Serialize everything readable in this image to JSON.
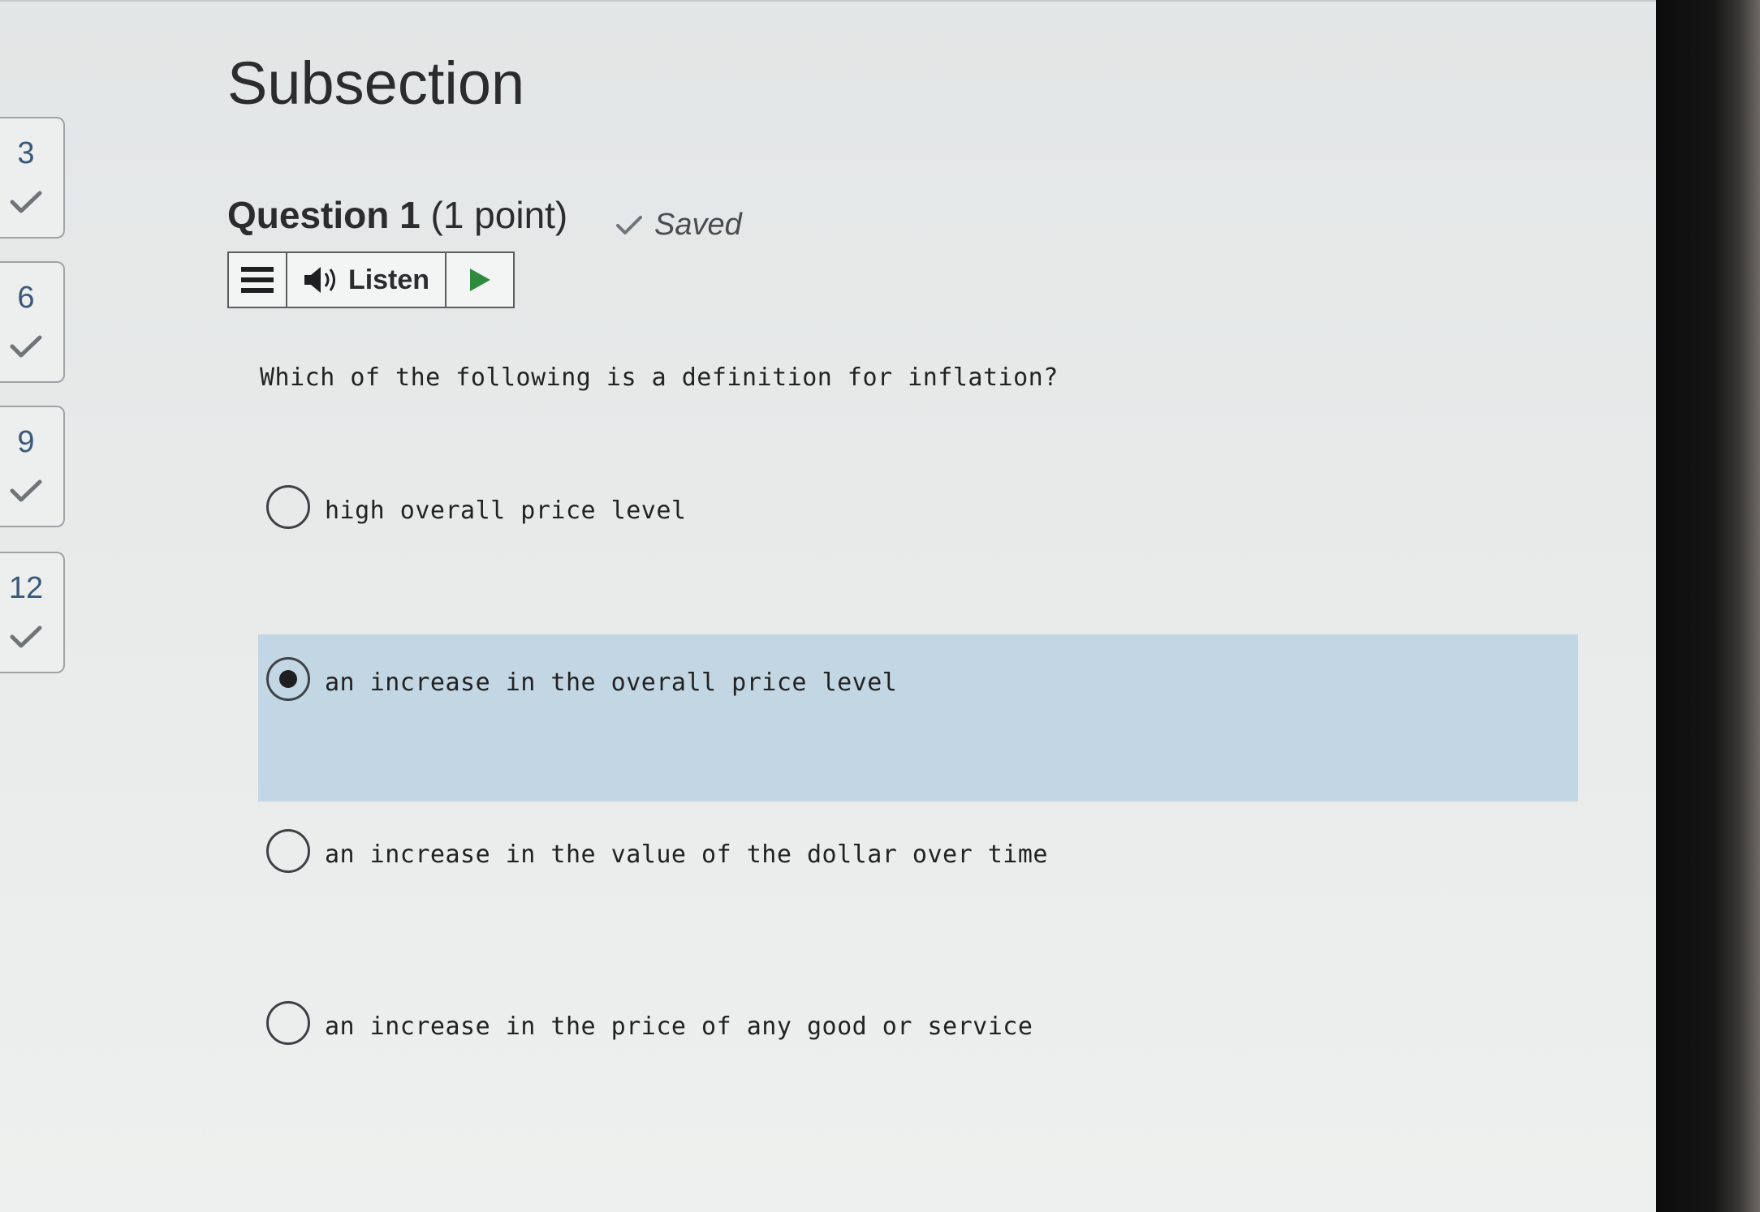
{
  "page": {
    "title": "Subsection"
  },
  "question_nav": [
    {
      "number": "3",
      "status": "answered"
    },
    {
      "number": "6",
      "status": "answered"
    },
    {
      "number": "9",
      "status": "answered"
    },
    {
      "number": "12",
      "status": "answered"
    }
  ],
  "question": {
    "label": "Question 1",
    "points": "(1 point)",
    "saved_label": "Saved",
    "prompt": "Which of the following is a definition for inflation?",
    "selected_index": 1,
    "options": [
      {
        "text": "high overall price level"
      },
      {
        "text": "an increase in the overall price level"
      },
      {
        "text": "an increase in the value of the dollar over time"
      },
      {
        "text": "an increase in the price of any good or service"
      }
    ]
  },
  "listen_toolbar": {
    "menu_icon": "hamburger-menu-icon",
    "speaker_icon": "speaker-icon",
    "listen_label": "Listen",
    "play_icon": "play-icon",
    "play_color": "#2e8b3e"
  },
  "colors": {
    "selected_option_bg": "#c3d6e3",
    "nav_number": "#3a5a7a",
    "check": "#6f7478"
  }
}
